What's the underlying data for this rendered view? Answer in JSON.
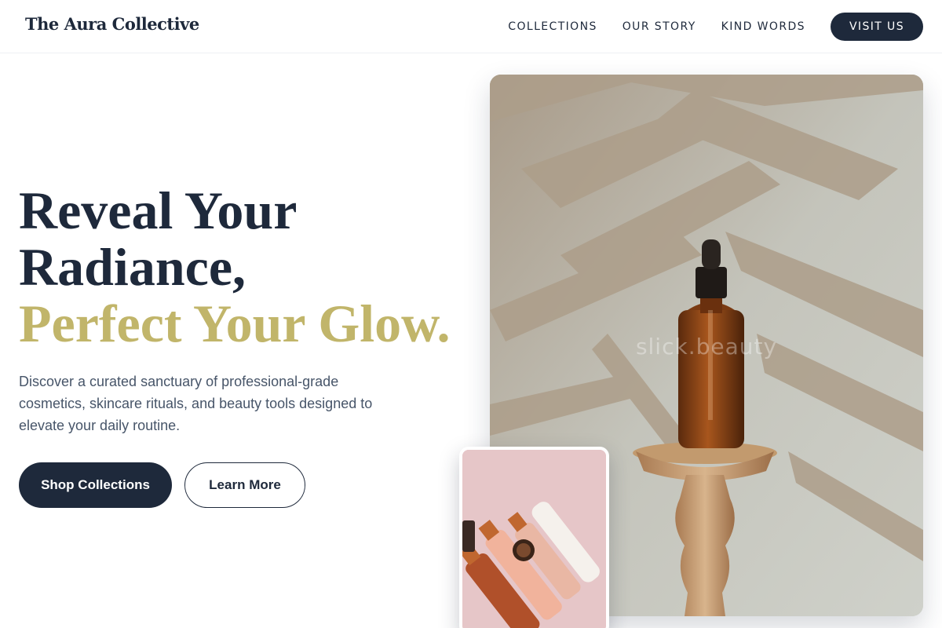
{
  "header": {
    "brand": "The Aura Collective",
    "nav": [
      "COLLECTIONS",
      "OUR STORY",
      "KIND WORDS"
    ],
    "cta": "VISIT US"
  },
  "hero": {
    "title_line1": "Reveal Your",
    "title_line2": "Radiance,",
    "title_accent": "Perfect Your Glow.",
    "description": "Discover a curated sanctuary of professional-grade cosmetics, skincare rituals, and beauty tools designed to elevate your daily routine.",
    "primary_button": "Shop Collections",
    "secondary_button": "Learn More"
  },
  "images": {
    "main_watermark": "slick.beauty",
    "main_icon": "serum-bottle-photo",
    "secondary_icon": "cosmetics-flatlay-photo"
  },
  "colors": {
    "navy": "#1e293b",
    "accent_gold": "#c1b56a",
    "body_text": "#475569"
  }
}
